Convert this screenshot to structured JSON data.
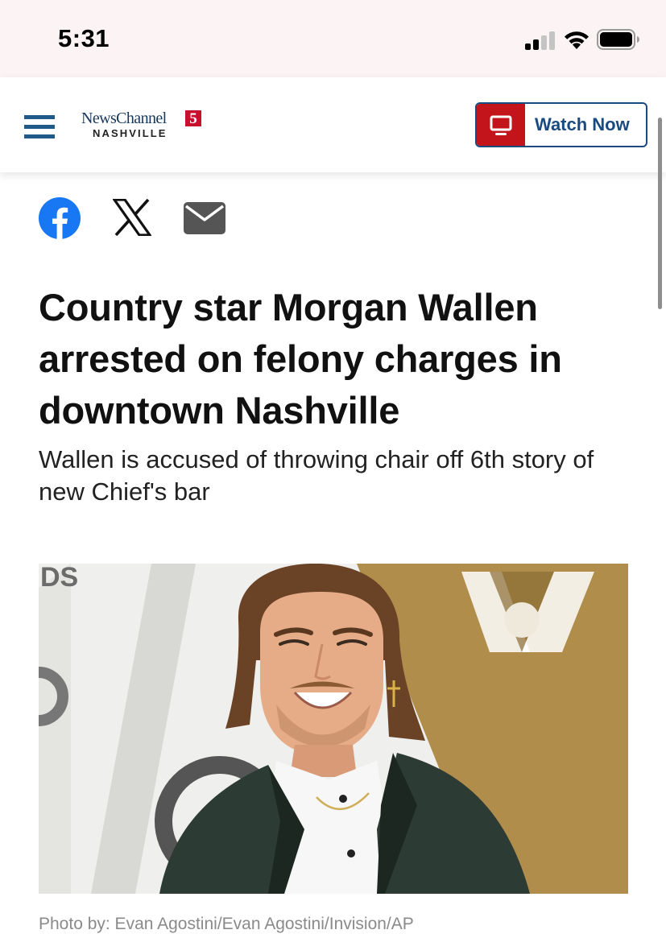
{
  "status_bar": {
    "time": "5:31",
    "icons": [
      "cellular-signal-icon",
      "wifi-icon",
      "battery-icon"
    ]
  },
  "header": {
    "menu_icon": "hamburger-menu-icon",
    "logo": {
      "top": "NewsChannel",
      "number": "5",
      "bottom": "NASHVILLE"
    },
    "watch_now": {
      "label": "Watch Now",
      "icon": "tv-icon"
    }
  },
  "share": {
    "icons": [
      "facebook-icon",
      "x-icon",
      "email-icon"
    ]
  },
  "article": {
    "headline": "Country star Morgan Wallen arrested on felony charges in downtown Nashville",
    "subheadline": "Wallen is accused of throwing chair off 6th story of new Chief's bar",
    "photo_credit": "Photo by: Evan Agostini/Evan Agostini/Invision/AP",
    "photo_backdrop_text": "DS"
  },
  "colors": {
    "status_bar_bg": "#fbf3f4",
    "brand_blue": "#1a4b80",
    "menu_blue": "#1e5a8a",
    "watch_red": "#c3141b",
    "logo_red": "#c8102e",
    "facebook_blue": "#1877f2",
    "backdrop_gold": "#b08d4a"
  }
}
